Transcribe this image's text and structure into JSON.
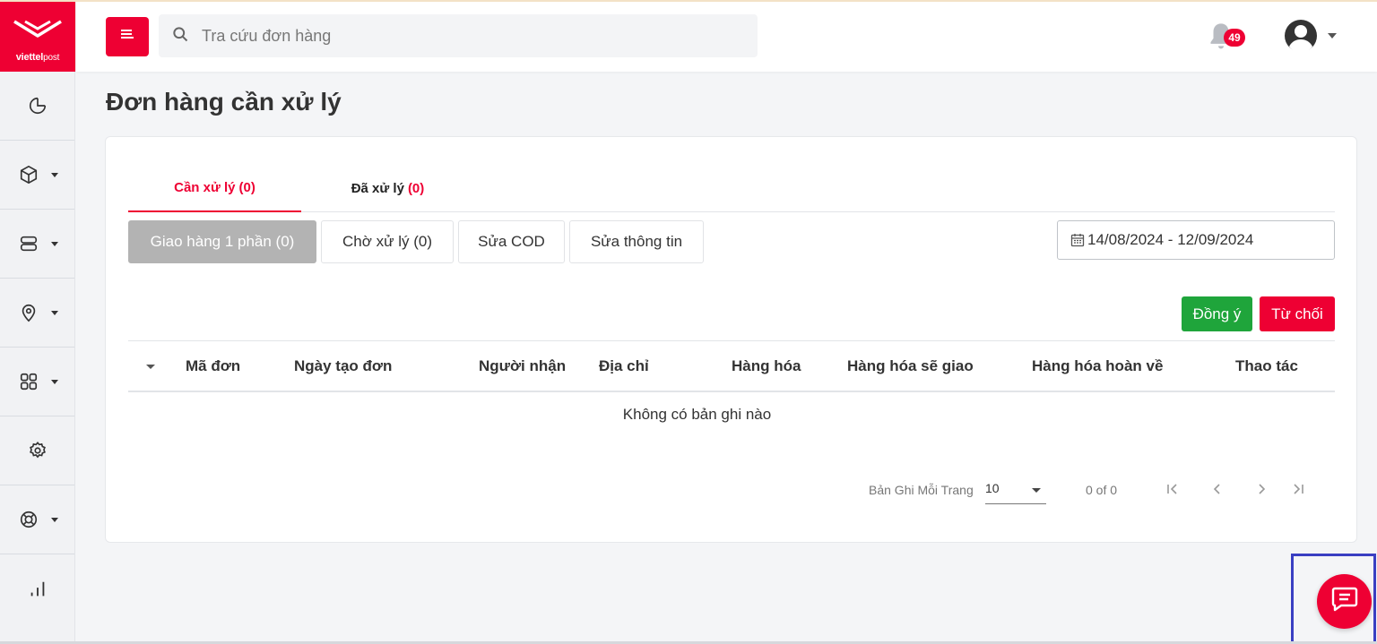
{
  "brand": {
    "name": "viettel",
    "sub": "post"
  },
  "header": {
    "search_placeholder": "Tra cứu đơn hàng",
    "notification_count": "49"
  },
  "page": {
    "title": "Đơn hàng cần xử lý"
  },
  "main_tabs": [
    {
      "label": "Cần xử lý",
      "count": "(0)"
    },
    {
      "label": "Đã xử lý",
      "count": "(0)"
    }
  ],
  "sub_tabs": [
    {
      "label": "Giao hàng 1 phần (0)"
    },
    {
      "label": "Chờ xử lý (0)"
    },
    {
      "label": "Sửa COD"
    },
    {
      "label": "Sửa thông tin"
    }
  ],
  "date_range": "14/08/2024 - 12/09/2024",
  "actions": {
    "accept": "Đồng ý",
    "reject": "Từ chối"
  },
  "table": {
    "columns": [
      "Mã đơn",
      "Ngày tạo đơn",
      "Người nhận",
      "Địa chỉ",
      "Hàng hóa",
      "Hàng hóa sẽ giao",
      "Hàng hóa hoàn về",
      "Thao tác"
    ],
    "empty_text": "Không có bản ghi nào"
  },
  "pagination": {
    "label": "Bản Ghi Mỗi Trang",
    "per_page": "10",
    "range": "0 of 0"
  },
  "colors": {
    "brand_red": "#ee0033",
    "accept_green": "#1fa53b"
  },
  "icons": [
    "menu-icon",
    "search-icon",
    "bell-icon",
    "user-icon",
    "chart-pie-icon",
    "box-icon",
    "server-icon",
    "location-icon",
    "apps-icon",
    "gear-icon",
    "lifebuoy-icon",
    "bar-chart-icon",
    "calendar-icon",
    "chat-icon"
  ]
}
